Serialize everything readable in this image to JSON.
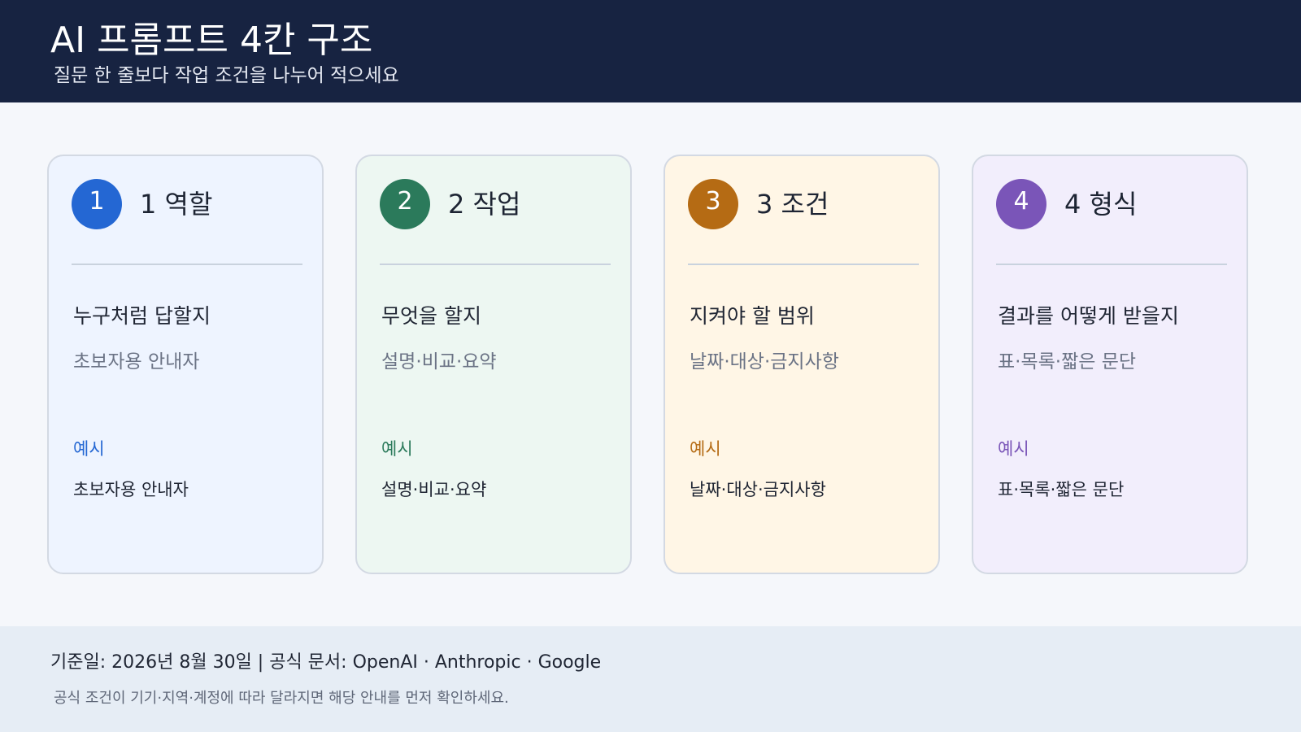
{
  "header": {
    "title": "AI 프롬프트 4칸 구조",
    "subtitle": "질문 한 줄보다 작업 조건을 나누어 적으세요"
  },
  "cards": [
    {
      "number": "1",
      "title": "1 역할",
      "question": "누구처럼 답할지",
      "hint": "초보자용 안내자",
      "example_label": "예시",
      "example_value": "초보자용 안내자",
      "accent": "#2467d3",
      "background": "#eef4ff"
    },
    {
      "number": "2",
      "title": "2 작업",
      "question": "무엇을 할지",
      "hint": "설명·비교·요약",
      "example_label": "예시",
      "example_value": "설명·비교·요약",
      "accent": "#2b7a5b",
      "background": "#edf7f2"
    },
    {
      "number": "3",
      "title": "3 조건",
      "question": "지켜야 할 범위",
      "hint": "날짜·대상·금지사항",
      "example_label": "예시",
      "example_value": "날짜·대상·금지사항",
      "accent": "#b56b14",
      "background": "#fff6e6"
    },
    {
      "number": "4",
      "title": "4 형식",
      "question": "결과를 어떻게 받을지",
      "hint": "표·목록·짧은 문단",
      "example_label": "예시",
      "example_value": "표·목록·짧은 문단",
      "accent": "#7a55b8",
      "background": "#f2eefc"
    }
  ],
  "footer": {
    "reference": "기준일: 2026년 8월 30일  |  공식 문서: OpenAI · Anthropic · Google",
    "note": "공식 조건이 기기·지역·계정에 따라 달라지면 해당 안내를 먼저 확인하세요."
  }
}
